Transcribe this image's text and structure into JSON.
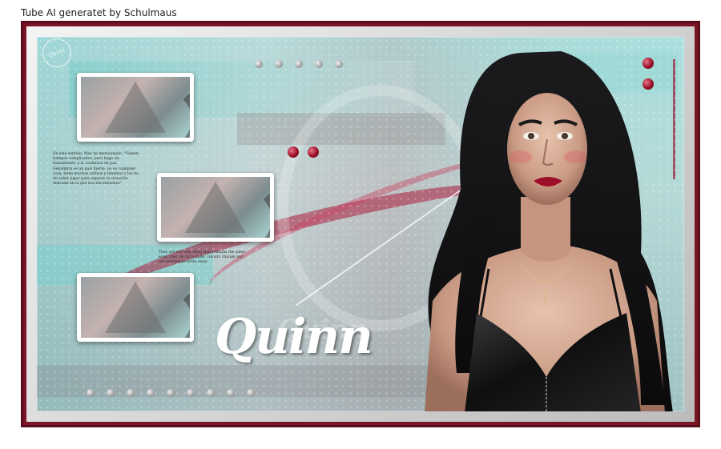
{
  "caption": "Tube AI generatet by Schulmaus",
  "title": "Quinn",
  "colors": {
    "frame": "#7b1424",
    "teal": "#a8dcd8",
    "accent_red": "#9c0f28",
    "pearl": "#a9a9a9"
  },
  "text_block_1": [
    "En este sentido, Max ha mencionado: \"Vienen",
    "tiempos complicados, pero hago un",
    "llamamiento a la confianza de paz.",
    "Gebalmira es un país fuerte, no es cualquier",
    "cosa, tiene muchos activos y tenemos y los ha",
    "de saber jugar para superar la situación",
    "delicada en la que nos encontramos\""
  ],
  "text_block_2": [
    "They are the only thing that remains the same",
    "even when features fade, colours change and",
    "our existences write away."
  ],
  "watermark": {
    "icon": "signature-seal-icon",
    "text": "Quinn"
  },
  "woman": {
    "description_icon": "portrait-photo"
  }
}
